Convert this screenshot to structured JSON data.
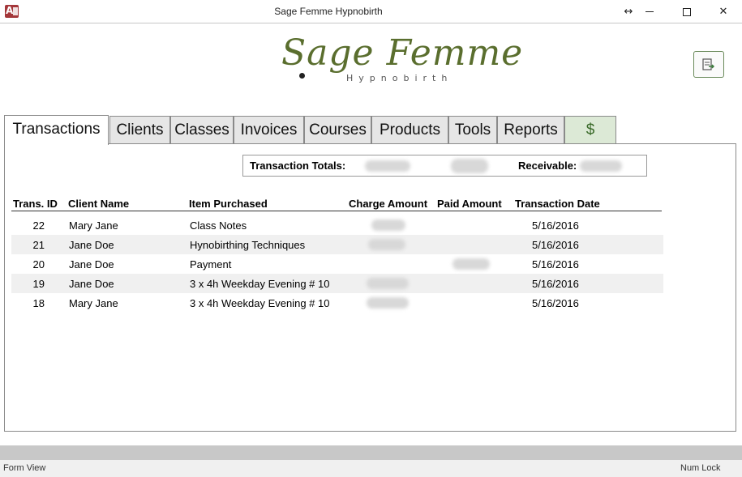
{
  "window": {
    "title": "Sage Femme Hypnobirth",
    "resize_glyph": "↔",
    "close_glyph": "✕"
  },
  "logo": {
    "main": "Sage Femme",
    "sub": "Hypnobirth"
  },
  "tabs": [
    {
      "label": "Transactions",
      "active": true
    },
    {
      "label": "Clients"
    },
    {
      "label": "Classes"
    },
    {
      "label": "Invoices"
    },
    {
      "label": "Courses"
    },
    {
      "label": "Products"
    },
    {
      "label": "Tools"
    },
    {
      "label": "Reports"
    },
    {
      "label": "$"
    }
  ],
  "totals": {
    "transaction_totals_label": "Transaction Totals:",
    "receivable_label": "Receivable:"
  },
  "table": {
    "columns": [
      "Trans. ID",
      "Client Name",
      "Item Purchased",
      "Charge Amount",
      "Paid Amount",
      "Transaction Date"
    ],
    "rows": [
      {
        "id": "22",
        "client": "Mary Jane",
        "item": "Class Notes",
        "date": "5/16/2016"
      },
      {
        "id": "21",
        "client": "Jane Doe",
        "item": "Hynobirthing Techniques",
        "date": "5/16/2016"
      },
      {
        "id": "20",
        "client": "Jane Doe",
        "item": "Payment",
        "date": "5/16/2016"
      },
      {
        "id": "19",
        "client": "Jane Doe",
        "item": "3 x 4h Weekday Evening # 10",
        "date": "5/16/2016"
      },
      {
        "id": "18",
        "client": "Mary Jane",
        "item": "3 x 4h Weekday Evening # 10",
        "date": "5/16/2016"
      }
    ]
  },
  "status": {
    "left": "Form View",
    "right": "Num Lock"
  },
  "colors": {
    "brand_green": "#5a6e2e",
    "access_red": "#a4373a"
  },
  "icons": [
    "access-app-icon",
    "export-icon"
  ]
}
